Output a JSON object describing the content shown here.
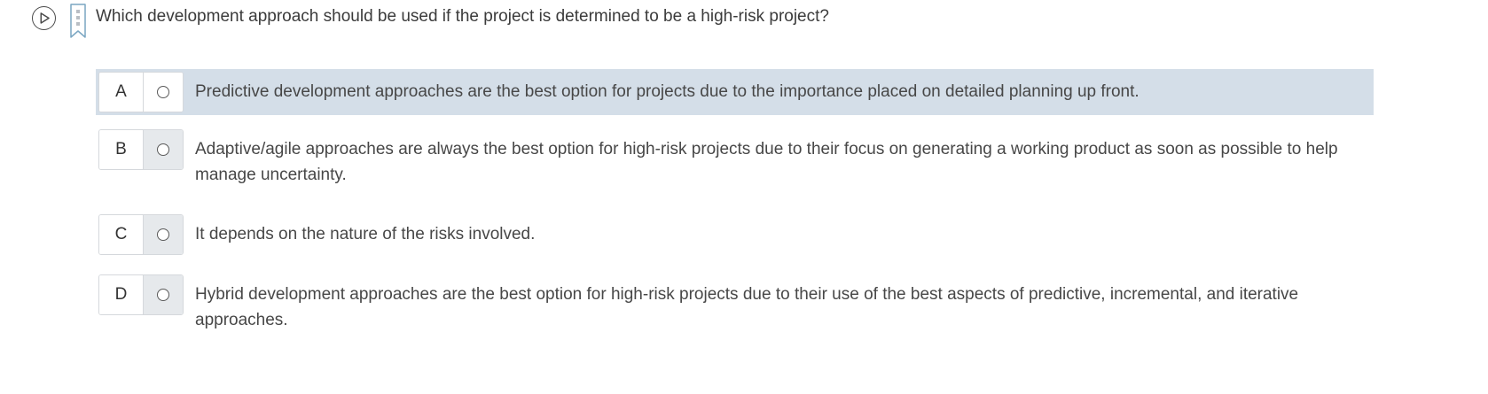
{
  "question": {
    "text": "Which development approach should be used if the project is determined to be a high-risk project?"
  },
  "icons": {
    "play": "play-circle-icon",
    "bookmark": "bookmark-icon"
  },
  "options": [
    {
      "letter": "A",
      "text": "Predictive development approaches are the best option for projects due to the importance placed on detailed planning up front.",
      "highlighted": true
    },
    {
      "letter": "B",
      "text": "Adaptive/agile approaches are always the best option for high-risk projects due to their focus on generating a working product as soon as possible to help manage uncertainty.",
      "highlighted": false
    },
    {
      "letter": "C",
      "text": "It depends on the nature of the risks involved.",
      "highlighted": false
    },
    {
      "letter": "D",
      "text": "Hybrid development approaches are the best option for high-risk projects due to their use of the best aspects of predictive, incremental, and iterative approaches.",
      "highlighted": false
    }
  ],
  "colors": {
    "highlight": "#d4dee8",
    "text": "#474747",
    "radio_cell": "#e6e9ec",
    "bookmark": "#7aa6c2"
  }
}
